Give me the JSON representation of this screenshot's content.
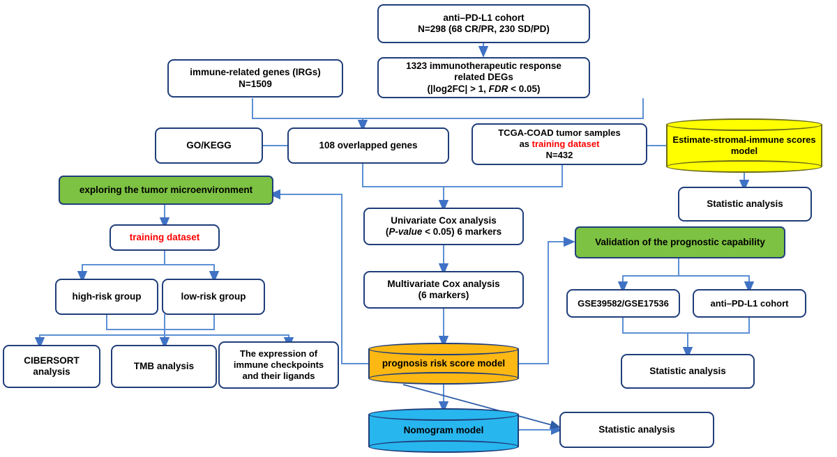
{
  "diagram": {
    "title": "Study workflow flowchart",
    "colors": {
      "box_border": "#1F3D7A",
      "edge": "#5B8FD4",
      "green_fill": "#7DC242",
      "yellow_fill": "#FFFF00",
      "orange_fill": "#FDB813",
      "blue_fill": "#28B6EF",
      "highlight_text": "#FF0000"
    }
  },
  "nodes": {
    "cohort": {
      "line1": "anti–PD-L1 cohort",
      "line2": "N=298 (68 CR/PR, 230 SD/PD)"
    },
    "degs": {
      "line1": "1323 immunotherapeutic response",
      "line2": "related DEGs",
      "line3_pre": "(|log2FC| > 1, ",
      "line3_ital": "FDR",
      "line3_post": " < 0.05)"
    },
    "irgs": {
      "line1": "immune-related genes (IRGs)",
      "line2": "N=1509"
    },
    "gokegg": {
      "label": "GO/KEGG"
    },
    "overlapped": {
      "label": "108 overlapped genes"
    },
    "tcga": {
      "line1": "TCGA-COAD tumor samples",
      "line2_pre": "as ",
      "line2_red": "training dataset",
      "line3": "N=432"
    },
    "estimate_model": {
      "line1": "Estimate-stromal-immune scores",
      "line2": "model"
    },
    "stat_top_right": {
      "label": "Statistic analysis"
    },
    "explore_tme": {
      "label": "exploring the tumor microenvironment"
    },
    "training_dataset": {
      "label": "training dataset"
    },
    "high_risk": {
      "label": "high-risk group"
    },
    "low_risk": {
      "label": "low-risk group"
    },
    "cibersort": {
      "line1": "CIBERSORT",
      "line2": "analysis"
    },
    "tmb": {
      "label": "TMB analysis"
    },
    "checkpoints": {
      "line1": "The expression of",
      "line2": "immune checkpoints",
      "line3": "and their ligands"
    },
    "univariate": {
      "line1": "Univariate Cox analysis",
      "line2_pre": "(",
      "line2_ital": "P-value",
      "line2_post": " < 0.05)  6 markers"
    },
    "multivariate": {
      "line1": "Multivariate Cox analysis",
      "line2": "(6 markers)"
    },
    "prognosis_model": {
      "label": "prognosis risk score model"
    },
    "nomogram_model": {
      "label": "Nomogram model"
    },
    "validation": {
      "label": "Validation of the prognostic capability"
    },
    "gse": {
      "label": "GSE39582/GSE17536"
    },
    "antipd": {
      "label": "anti–PD-L1 cohort"
    },
    "stat_mid_right": {
      "label": "Statistic analysis"
    },
    "stat_bottom_right": {
      "label": "Statistic analysis"
    }
  }
}
